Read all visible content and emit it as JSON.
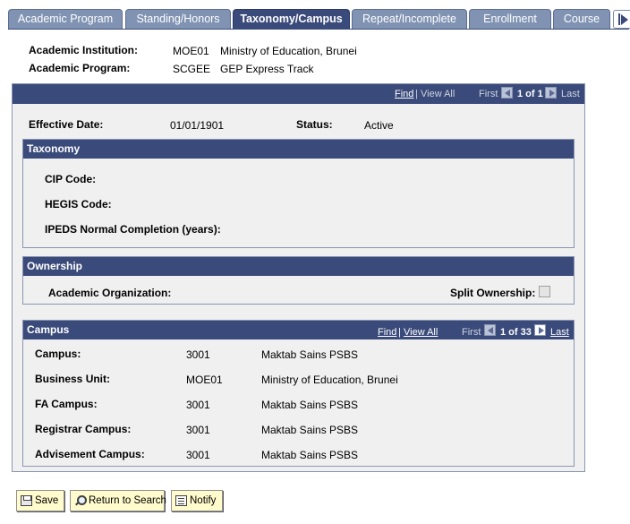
{
  "tabs": [
    {
      "label": "Academic Program",
      "active": false
    },
    {
      "label": "Standing/Honors",
      "active": false
    },
    {
      "label": "Taxonomy/Campus",
      "active": true
    },
    {
      "label": "Repeat/Incomplete",
      "active": false
    },
    {
      "label": "Enrollment",
      "active": false
    },
    {
      "label": "Course",
      "active": false
    }
  ],
  "header": {
    "institution_label": "Academic Institution:",
    "institution_code": "MOE01",
    "institution_name": "Ministry of Education, Brunei",
    "program_label": "Academic Program:",
    "program_code": "SCGEE",
    "program_name": "GEP Express Track"
  },
  "main_nav": {
    "find": "Find",
    "separator": "|",
    "view_all": "View All",
    "first": "First",
    "position": "1 of 1",
    "last": "Last"
  },
  "effective": {
    "date_label": "Effective Date:",
    "date_value": "01/01/1901",
    "status_label": "Status:",
    "status_value": "Active"
  },
  "taxonomy": {
    "title": "Taxonomy",
    "cip_label": "CIP Code:",
    "hegis_label": "HEGIS Code:",
    "ipeds_label": "IPEDS Normal Completion (years):"
  },
  "ownership": {
    "title": "Ownership",
    "org_label": "Academic Organization:",
    "split_label": "Split Ownership:",
    "split_checked": false
  },
  "campus": {
    "title": "Campus",
    "nav": {
      "find": "Find",
      "separator": "|",
      "view_all": "View All",
      "first": "First",
      "position": "1 of 33",
      "last": "Last"
    },
    "rows": [
      {
        "label": "Campus:",
        "code": "3001",
        "desc": "Maktab Sains PSBS"
      },
      {
        "label": "Business Unit:",
        "code": "MOE01",
        "desc": "Ministry of Education, Brunei"
      },
      {
        "label": "FA Campus:",
        "code": "3001",
        "desc": "Maktab Sains PSBS"
      },
      {
        "label": "Registrar Campus:",
        "code": "3001",
        "desc": "Maktab Sains PSBS"
      },
      {
        "label": "Advisement Campus:",
        "code": "3001",
        "desc": "Maktab Sains PSBS"
      }
    ]
  },
  "buttons": {
    "save": "Save",
    "return_to_search": "Return to Search",
    "notify": "Notify"
  },
  "icons": {
    "save": "save-icon",
    "search": "search-icon",
    "notify": "notify-icon",
    "prev": "chevron-left-icon",
    "next": "chevron-right-icon",
    "tab_scroll": "tab-scroll-right-icon"
  },
  "colors": {
    "bar": "#3a4a7a",
    "tab": "#8093b3",
    "panel": "#f0f0f0",
    "button": "#fffbcc"
  }
}
